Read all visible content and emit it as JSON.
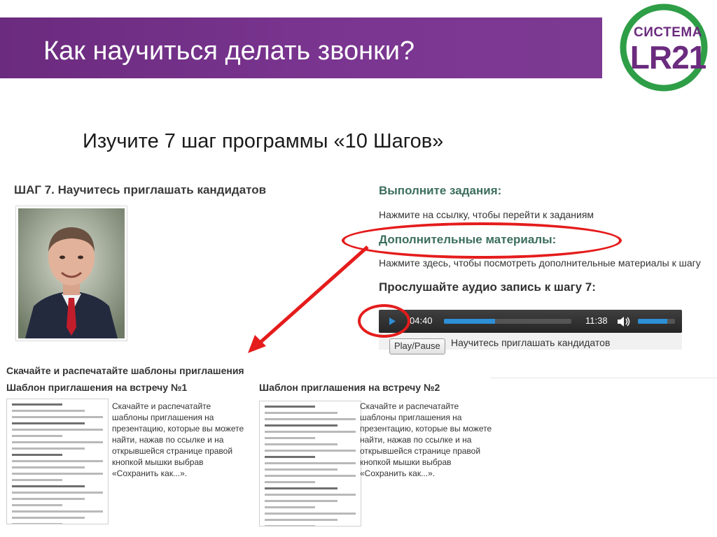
{
  "slide": {
    "title": "Как научиться делать звонки?",
    "subtitle": "Изучите 7 шаг программы «10 Шагов»",
    "colors": {
      "banner": "#7a3590",
      "logo_ring": "#2e9e47",
      "annotation": "#e51c1c"
    }
  },
  "logo": {
    "line1": "СИСТЕМА",
    "line2": "LR21"
  },
  "step": {
    "title": "ШАГ 7. Научитесь приглашать кандидатов",
    "tasks_heading": "Выполните задания:",
    "tasks_link": "Нажмите на ссылку, чтобы перейти к заданиям",
    "materials_heading": "Дополнительные материалы:",
    "materials_link": "Нажмите здесь, чтобы посмотреть дополнительные материалы к шагу",
    "audio_heading": "Прослушайте аудио запись к шагу 7:"
  },
  "player": {
    "current_time": "04:40",
    "total_time": "11:38",
    "progress": 0.4,
    "volume": 0.8,
    "play_pause_label": "Play/Pause",
    "caption": "Научитесь приглашать кандидатов"
  },
  "templates": {
    "section_title": "Скачайте и распечатайте шаблоны приглашения",
    "items": [
      {
        "heading": "Шаблон приглашения на встречу №1",
        "description": "Скачайте и распечатайте шаблоны приглашения на презентацию, которые вы можете найти, нажав по ссылке и на открывшейся странице правой кнопкой мышки выбрав «Сохранить как...»."
      },
      {
        "heading": "Шаблон приглашения на встречу №2",
        "description": "Скачайте и распечатайте шаблоны приглашения на презентацию, которые вы можете найти, нажав по ссылке и на открывшейся странице правой кнопкой мышки выбрав «Сохранить как...»."
      }
    ]
  }
}
